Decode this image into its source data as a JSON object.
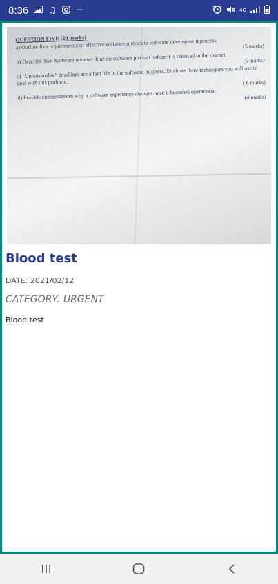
{
  "status_bar": {
    "time": "8:36",
    "network_label": "4G"
  },
  "note": {
    "title": "Blood test",
    "date": "DATE: 2021/02/12",
    "category": "CATEGORY: URGENT",
    "body": "Blood test"
  },
  "photo": {
    "question_title": "QUESTION FIVE (20 marks)",
    "lines": [
      {
        "text": "a)  Outline five requirements of effective software metrics in software development process",
        "mark": "(5 marks)"
      },
      {
        "text": "b)  Describe Two Software reviews done on software product before it is released to the market",
        "mark": "(5 marks)"
      },
      {
        "text": "c)  \"Unreasonable\" deadlines are a fact life in the software business. Evaluate three techniques you will use to deal with this problem.",
        "mark": "( 6 marks)"
      },
      {
        "text": "d)  Provide circumstances why a software experience changes once it becomes operational",
        "mark": "(4 marks)"
      }
    ]
  },
  "colors": {
    "status_bar": "#2a3d93",
    "frame": "#00897b",
    "title": "#2a3d93"
  }
}
